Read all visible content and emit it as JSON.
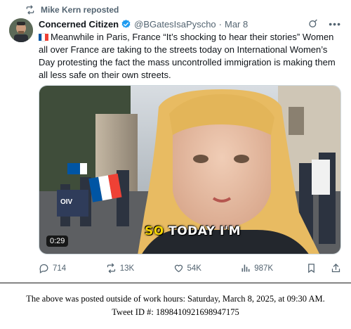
{
  "repost": {
    "text": "Mike Kern reposted"
  },
  "author": {
    "name": "Concerned Citizen",
    "handle": "@BGatesIsaPyscho",
    "separator": "·",
    "date": "Mar 8"
  },
  "tweet": {
    "text": "Meanwhile in Paris, France “It’s shocking to hear their stories” Women all over France are taking to the streets today on International Women’s Day protesting the fact the mass uncontrolled immigration is making them all less safe on their own streets."
  },
  "video": {
    "duration": "0:29",
    "caption_highlight": "SO",
    "caption_rest": " TODAY I'M",
    "sign_text": "OIV"
  },
  "metrics": {
    "replies": "714",
    "reposts": "13K",
    "likes": "54K",
    "views": "987K"
  },
  "footer": {
    "line1": "The above was posted outside of work hours: Saturday, March 8, 2025, at 09:30 AM.",
    "line2": "Tweet ID #: 1898410921698947175"
  },
  "colors": {
    "secondary_text": "#536471",
    "verified_blue": "#1d9bf0",
    "caption_yellow": "#f5d400",
    "flag_blue": "#0055a4",
    "flag_red": "#ef4135"
  },
  "icons": [
    "repost-icon",
    "verified-badge-icon",
    "grok-icon",
    "more-icon",
    "france-flag-icon",
    "reply-icon",
    "like-icon",
    "views-icon",
    "bookmark-icon",
    "share-icon"
  ]
}
